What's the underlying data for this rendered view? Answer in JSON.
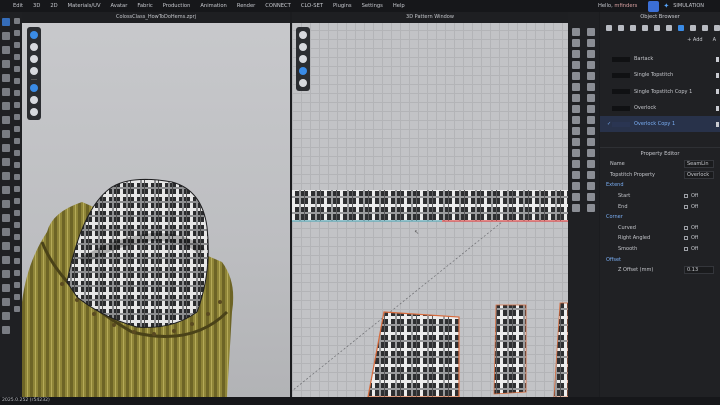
{
  "menu": [
    "Edit",
    "3D",
    "2D",
    "Materials/UV",
    "Avatar",
    "Fabric",
    "Production",
    "Animation",
    "Render",
    "CONNECT",
    "CLO-SET",
    "Plugins",
    "Settings",
    "Help"
  ],
  "user": {
    "greeting": "Hello,",
    "name": "mfinders"
  },
  "simulation_label": "SIMULATION",
  "window_3d": {
    "title": "ColossClass_HowToDoHems.zprj"
  },
  "window_2d": {
    "title": "3D Pattern Window"
  },
  "object_browser": {
    "title": "Object Browser",
    "add_label": "+ Add",
    "extra_label": "A",
    "items": [
      {
        "label": "Bartack",
        "selected": false
      },
      {
        "label": "Single Topstitch",
        "selected": false
      },
      {
        "label": "Single Topstitch Copy 1",
        "selected": false
      },
      {
        "label": "Overlock",
        "selected": false
      },
      {
        "label": "Overlock Copy 1",
        "selected": true
      }
    ]
  },
  "property_editor": {
    "title": "Property Editor",
    "name_label": "Name",
    "name_value": "SeamLin",
    "topstitch_label": "Topstitch Property",
    "topstitch_value": "Overlock",
    "extend_label": "Extend",
    "start_label": "Start",
    "start_value": "Off",
    "end_label": "End",
    "end_value": "Off",
    "corner_label": "Corner",
    "curved_label": "Curved",
    "curved_value": "Off",
    "right_angled_label": "Right Angled",
    "right_angled_value": "Off",
    "smooth_label": "Smooth",
    "smooth_value": "Off",
    "offset_label": "Offset",
    "z_offset_label": "Z Offset (mm)",
    "z_offset_value": "0.13"
  },
  "status_text": "2025.0.252 (r54232)"
}
